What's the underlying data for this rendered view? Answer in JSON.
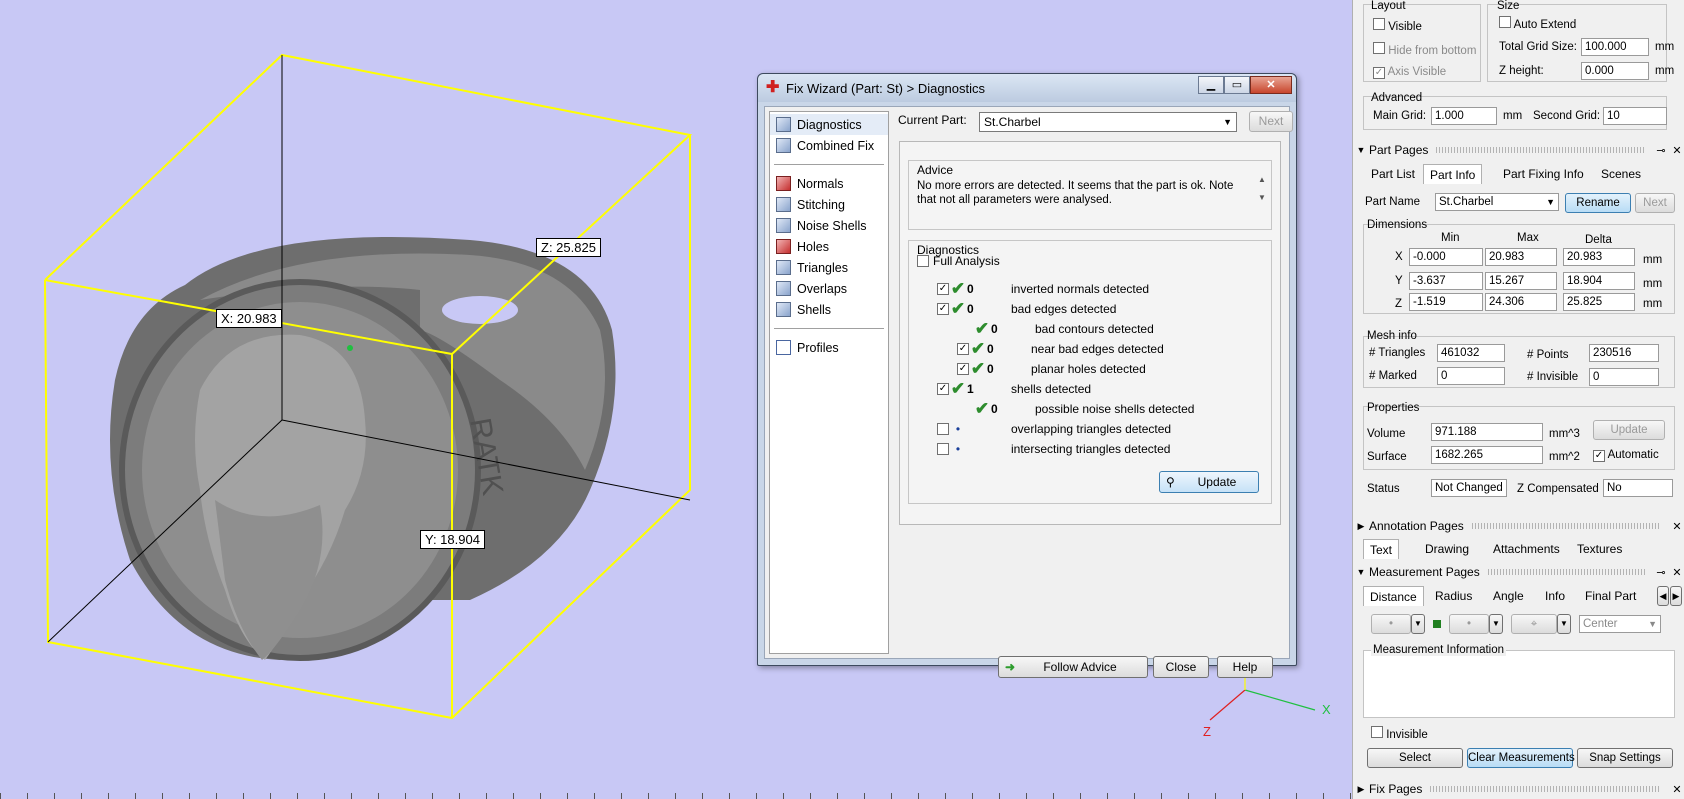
{
  "viewport": {
    "labels": {
      "x": "X: 20.983",
      "y": "Y: 18.904",
      "z": "Z: 25.825"
    },
    "axes": {
      "x": "X",
      "z": "Z"
    },
    "colors": {
      "background": "#c8c8f5",
      "bbox": "#ffff00"
    }
  },
  "wizard": {
    "title": "Fix Wizard (Part: St) > Diagnostics",
    "nav": [
      {
        "label": "Diagnostics",
        "icon": "magnifier-icon"
      },
      {
        "label": "Combined Fix",
        "icon": "cube-icon"
      },
      {
        "label": "Normals",
        "icon": "cube-red-icon"
      },
      {
        "label": "Stitching",
        "icon": "cube-icon"
      },
      {
        "label": "Noise Shells",
        "icon": "cube-icon"
      },
      {
        "label": "Holes",
        "icon": "cube-red-icon"
      },
      {
        "label": "Triangles",
        "icon": "cube-icon"
      },
      {
        "label": "Overlaps",
        "icon": "cube-icon"
      },
      {
        "label": "Shells",
        "icon": "cube-icon"
      },
      {
        "label": "Profiles",
        "icon": "document-icon"
      }
    ],
    "current_part_label": "Current Part:",
    "current_part_value": "St.Charbel",
    "next_button": "Next",
    "advice_title": "Advice",
    "advice_text": "No more errors are detected. It seems that the part is ok. Note that not all parameters were analysed.",
    "diagnostics_title": "Diagnostics",
    "full_analysis": "Full Analysis",
    "rows": [
      {
        "count": "0",
        "label": "inverted normals detected"
      },
      {
        "count": "0",
        "label": "bad edges detected"
      },
      {
        "count": "0",
        "label": "bad contours detected"
      },
      {
        "count": "0",
        "label": "near bad edges detected"
      },
      {
        "count": "0",
        "label": "planar holes detected"
      },
      {
        "count": "1",
        "label": "shells detected"
      },
      {
        "count": "0",
        "label": "possible noise shells detected"
      },
      {
        "count": "",
        "label": "overlapping triangles detected"
      },
      {
        "count": "",
        "label": "intersecting triangles detected"
      }
    ],
    "update_button": "Update",
    "follow_advice_button": "Follow Advice",
    "close_button": "Close",
    "help_button": "Help"
  },
  "panel": {
    "layout": {
      "title": "Layout",
      "visible": "Visible",
      "hide_from_bottom": "Hide from bottom",
      "axis_visible": "Axis Visible"
    },
    "size": {
      "title": "Size",
      "auto_extend": "Auto Extend",
      "total_grid_label": "Total Grid Size:",
      "total_grid_value": "100.000",
      "total_grid_unit": "mm",
      "z_height_label": "Z height:",
      "z_height_value": "0.000",
      "z_height_unit": "mm"
    },
    "advanced": {
      "title": "Advanced",
      "main_grid_label": "Main Grid:",
      "main_grid_value": "1.000",
      "main_grid_unit": "mm",
      "second_grid_label": "Second Grid:",
      "second_grid_value": "10"
    },
    "part_pages": {
      "title": "Part Pages",
      "tabs": [
        "Part List",
        "Part Info",
        "Part Fixing Info",
        "Scenes"
      ],
      "part_name_label": "Part Name",
      "part_name_value": "St.Charbel",
      "rename_button": "Rename",
      "next_button": "Next",
      "dimensions_title": "Dimensions",
      "dim_headers": [
        "Min",
        "Max",
        "Delta"
      ],
      "dims": [
        {
          "axis": "X",
          "min": "-0.000",
          "max": "20.983",
          "delta": "20.983",
          "unit": "mm"
        },
        {
          "axis": "Y",
          "min": "-3.637",
          "max": "15.267",
          "delta": "18.904",
          "unit": "mm"
        },
        {
          "axis": "Z",
          "min": "-1.519",
          "max": "24.306",
          "delta": "25.825",
          "unit": "mm"
        }
      ],
      "mesh_title": "Mesh info",
      "triangles_label": "# Triangles",
      "triangles_value": "461032",
      "points_label": "# Points",
      "points_value": "230516",
      "marked_label": "# Marked",
      "marked_value": "0",
      "invisible_label": "# Invisible",
      "invisible_value": "0",
      "properties_title": "Properties",
      "volume_label": "Volume",
      "volume_value": "971.188",
      "volume_unit": "mm^3",
      "surface_label": "Surface",
      "surface_value": "1682.265",
      "surface_unit": "mm^2",
      "update_button": "Update",
      "automatic_label": "Automatic",
      "status_label": "Status",
      "status_value": "Not Changed",
      "zcomp_label": "Z Compensated",
      "zcomp_value": "No"
    },
    "annotation_pages": {
      "title": "Annotation Pages",
      "tabs": [
        "Text",
        "Drawing",
        "Attachments",
        "Textures"
      ]
    },
    "measurement_pages": {
      "title": "Measurement Pages",
      "tabs": [
        "Distance",
        "Radius",
        "Angle",
        "Info",
        "Final Part"
      ],
      "center_value": "Center",
      "info_title": "Measurement Information",
      "invisible_label": "Invisible",
      "select_button": "Select",
      "clear_button": "Clear Measurements",
      "snap_button": "Snap Settings"
    },
    "fix_pages": {
      "title": "Fix Pages"
    }
  }
}
